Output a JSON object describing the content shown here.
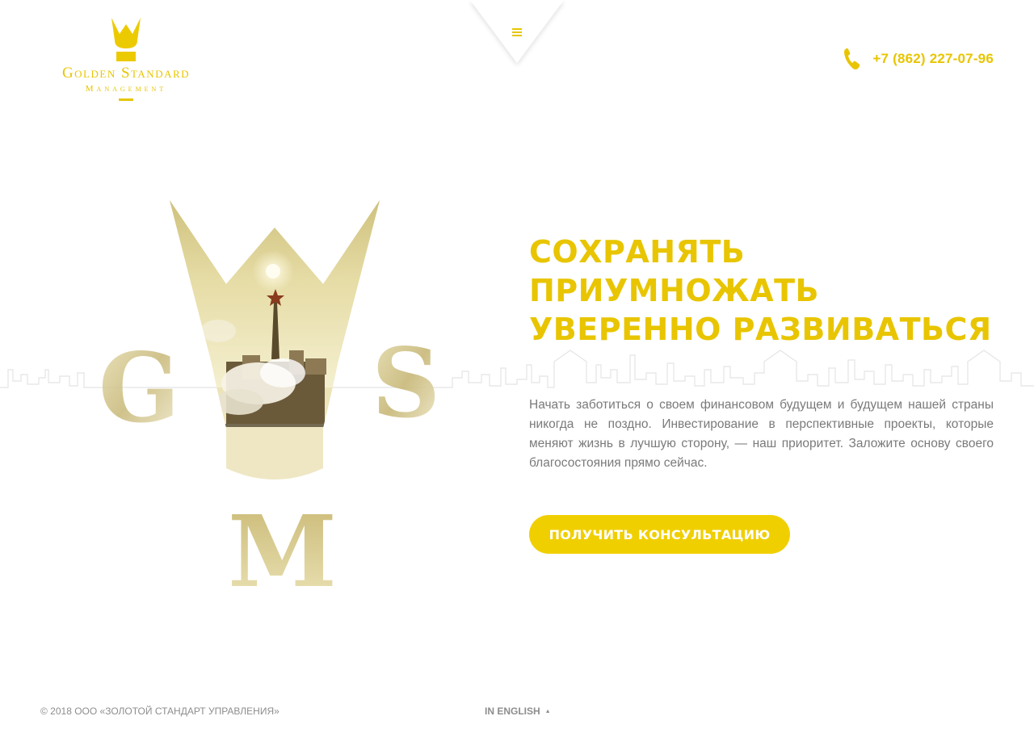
{
  "logo": {
    "name": "Golden Standard",
    "subtitle": "Management"
  },
  "header": {
    "menu_icon": "hamburger-icon",
    "phone_icon": "phone-icon",
    "phone": "+7 (862) 227-07-96"
  },
  "hero": {
    "emblem_letters": [
      "G",
      "S",
      "M"
    ],
    "title_lines": [
      "СОХРАНЯТЬ",
      "ПРИУМНОЖАТЬ",
      "УВЕРЕННО РАЗВИВАТЬСЯ"
    ],
    "description": "Начать заботиться о своем финансовом будущем и будущем нашей страны никогда не поздно. Инвестирование в перспективные проекты, которые меняют жизнь в лучшую сторону, — наш приоритет. Заложите основу своего благосостояния прямо сейчас.",
    "cta_label": "ПОЛУЧИТЬ КОНСУЛЬТАЦИЮ"
  },
  "footer": {
    "copyright": "© 2018 ООО «ЗОЛОТОЙ СТАНДАРТ УПРАВЛЕНИЯ»",
    "language_link": "IN ENGLISH",
    "language_arrow_icon": "triangle-up-icon"
  },
  "colors": {
    "accent": "#e8c500",
    "button": "#f0cf00",
    "text_muted": "#7a7a7a",
    "footer_text": "#8d8d8d"
  }
}
